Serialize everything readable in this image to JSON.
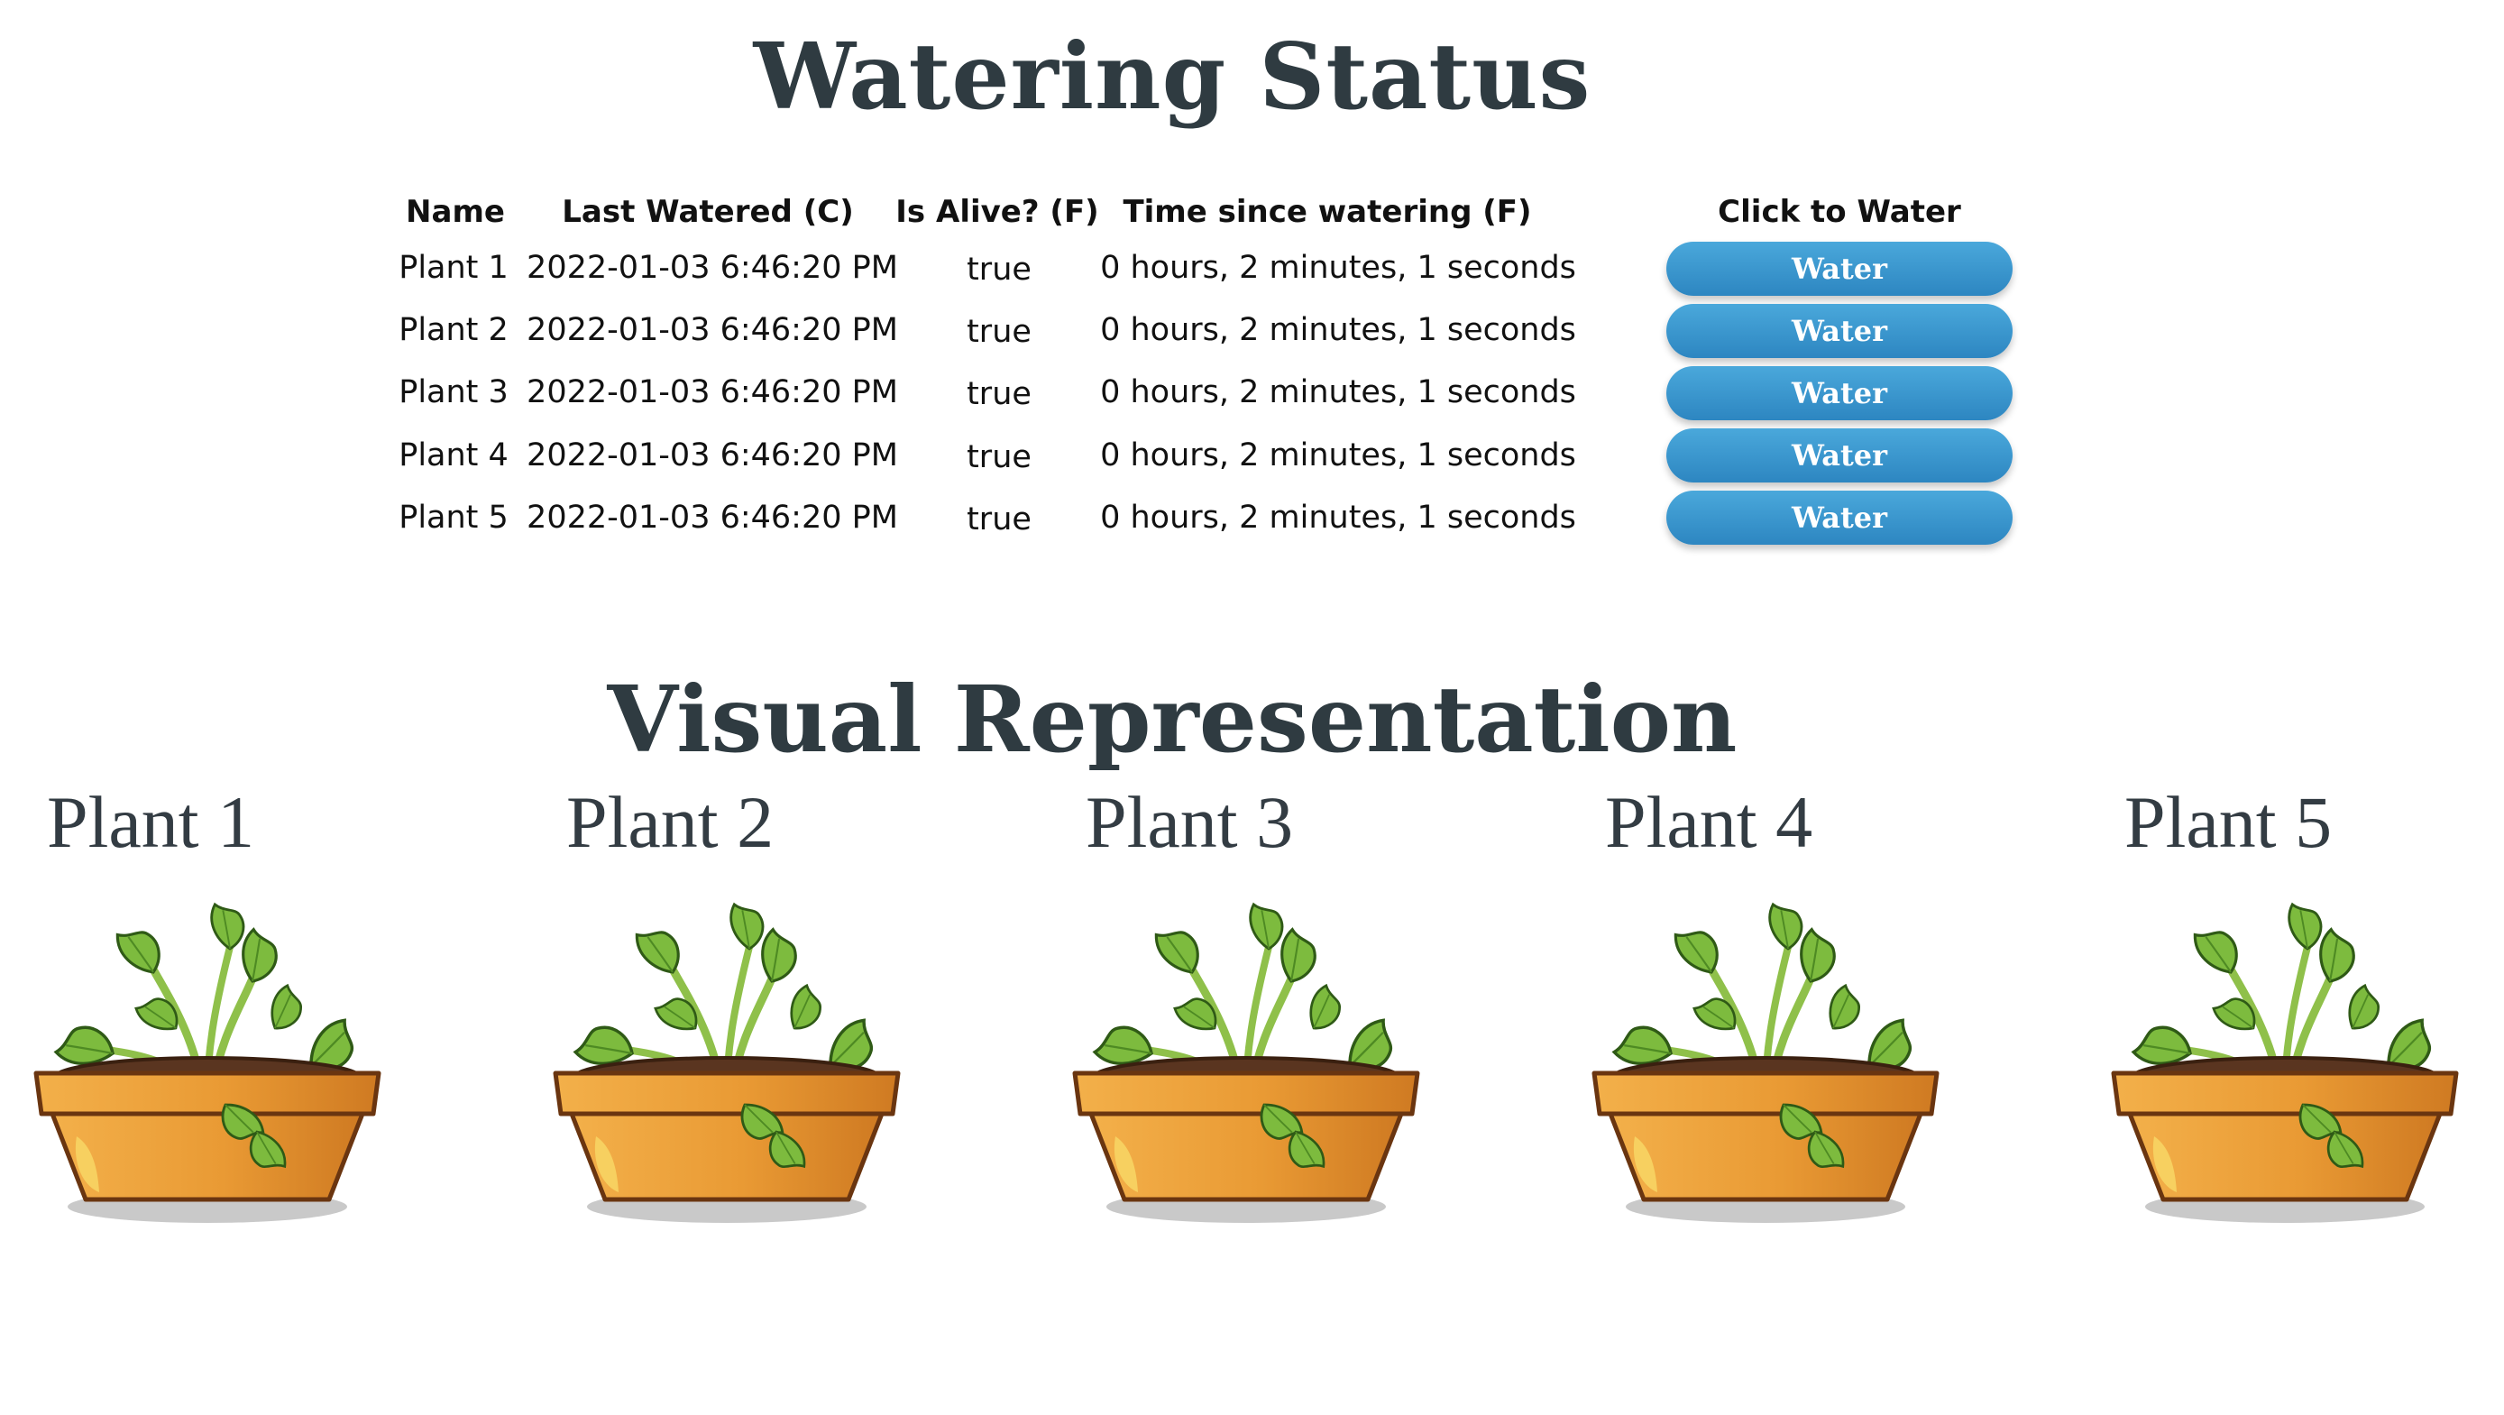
{
  "header": {
    "title": "Watering Status"
  },
  "table": {
    "headers": {
      "name": "Name",
      "last_watered": "Last Watered (C)",
      "is_alive": "Is Alive? (F)",
      "time_since": "Time since watering (F)",
      "action": "Click to Water"
    },
    "rows": [
      {
        "name": "Plant 1",
        "last_watered": "2022-01-03 6:46:20 PM",
        "is_alive": "true",
        "time_since": "0 hours, 2 minutes, 1 seconds",
        "button": "Water"
      },
      {
        "name": "Plant 2",
        "last_watered": "2022-01-03 6:46:20 PM",
        "is_alive": "true",
        "time_since": "0 hours, 2 minutes, 1 seconds",
        "button": "Water"
      },
      {
        "name": "Plant 3",
        "last_watered": "2022-01-03 6:46:20 PM",
        "is_alive": "true",
        "time_since": "0 hours, 2 minutes, 1 seconds",
        "button": "Water"
      },
      {
        "name": "Plant 4",
        "last_watered": "2022-01-03 6:46:20 PM",
        "is_alive": "true",
        "time_since": "0 hours, 2 minutes, 1 seconds",
        "button": "Water"
      },
      {
        "name": "Plant 5",
        "last_watered": "2022-01-03 6:46:20 PM",
        "is_alive": "true",
        "time_since": "0 hours, 2 minutes, 1 seconds",
        "button": "Water"
      }
    ]
  },
  "visual": {
    "title": "Visual Representation",
    "plants": [
      {
        "label": "Plant 1",
        "icon": "potted-plant-icon"
      },
      {
        "label": "Plant 2",
        "icon": "potted-plant-icon"
      },
      {
        "label": "Plant 3",
        "icon": "potted-plant-icon"
      },
      {
        "label": "Plant 4",
        "icon": "potted-plant-icon"
      },
      {
        "label": "Plant 5",
        "icon": "potted-plant-icon"
      }
    ]
  },
  "colors": {
    "button": "#3598d0",
    "heading": "#2f3b41",
    "pot": "#e99a34",
    "leaf": "#7dbb3e"
  }
}
